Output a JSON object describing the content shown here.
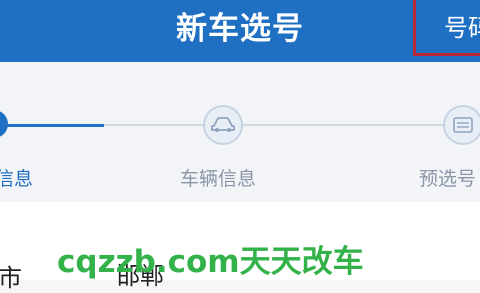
{
  "header": {
    "title": "新车选号",
    "right_button": "号码"
  },
  "steps": [
    {
      "label": "信息",
      "active": true
    },
    {
      "label": "车辆信息",
      "active": false,
      "icon": "car-icon"
    },
    {
      "label": "预选号",
      "active": false,
      "icon": "plate-icon"
    }
  ],
  "form": {
    "city_label": "市",
    "city_value": "邯郸"
  },
  "watermark": "cqzzb.com天天改车",
  "colors": {
    "primary": "#1f6fc2",
    "watermark": "#33b24a",
    "highlight_border": "#c0263a"
  }
}
